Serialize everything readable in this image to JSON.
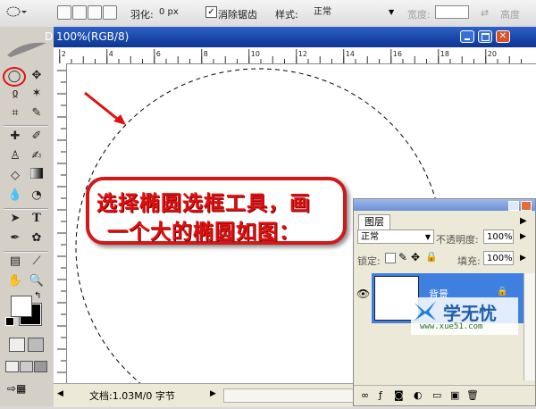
{
  "options_bar": {
    "feather_label": "羽化:",
    "feather_value": "0 px",
    "antialias_label": "消除锯齿",
    "style_label": "样式:",
    "style_value": "正常",
    "width_label": "宽度:",
    "height_label": "高度"
  },
  "document": {
    "title": "D 100%(RGB/8)",
    "ruler_ticks": [
      "2",
      "4",
      "6",
      "8",
      "10",
      "12",
      "14",
      "16",
      "18",
      "20"
    ],
    "status_text": "文档:1.03M/0 字节"
  },
  "layers_panel": {
    "tab_label": "图层",
    "blend_mode": "正常",
    "opacity_label": "不透明度:",
    "opacity_value": "100%",
    "lock_label": "锁定:",
    "fill_label": "填充:",
    "fill_value": "100%",
    "layer_name": "背景"
  },
  "callout": {
    "line1": "选择椭圆选框工具，画",
    "line2": "一个大的椭圆如图："
  },
  "watermark": {
    "brand": "学无忧",
    "url": "www.xue51.com"
  },
  "colors": {
    "title_bar": "#1746a8",
    "callout_red": "#d21818",
    "layer_selected": "#3f7fe0"
  }
}
